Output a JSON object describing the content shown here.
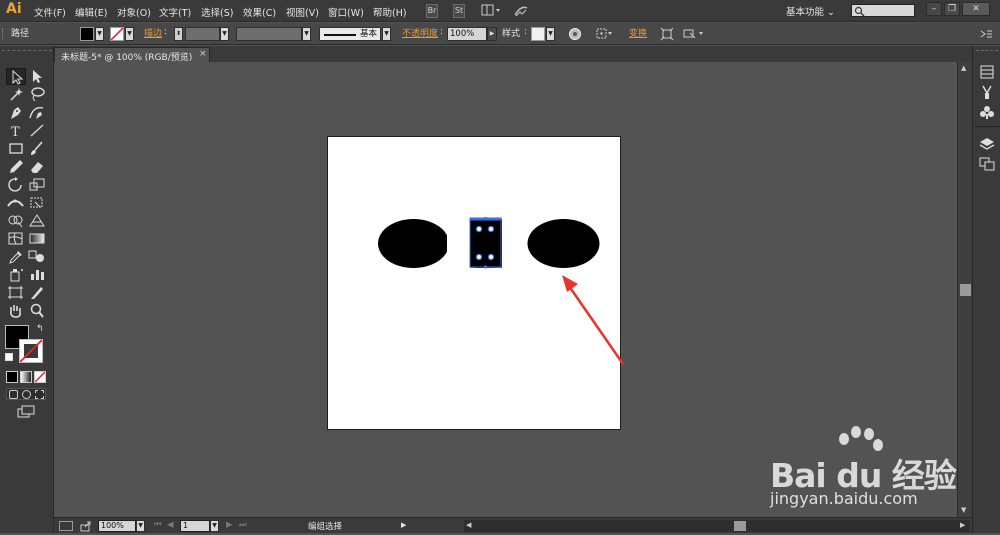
{
  "app": {
    "logo_text": "Ai"
  },
  "menu": {
    "items": [
      "文件(F)",
      "编辑(E)",
      "对象(O)",
      "文字(T)",
      "选择(S)",
      "效果(C)",
      "视图(V)",
      "窗口(W)",
      "帮助(H)"
    ],
    "br_label": "Br",
    "st_label": "St",
    "workspace_label": "基本功能 ⌄",
    "search_placeholder": ""
  },
  "control_bar": {
    "selection_label": "路径",
    "stroke_label": "描边",
    "stroke_style_label": "基本",
    "opacity_label": "不透明度",
    "opacity_value": "100%",
    "style_label": "样式",
    "transform_label": "变换",
    "fill_color": "#000000",
    "accent_color": "#e89a3c"
  },
  "document": {
    "tab_title": "未标题-5* @ 100% (RGB/预览)",
    "tab_close": "×"
  },
  "status_bar": {
    "zoom_value": "100%",
    "page_value": "1",
    "tool_status": "编组选择"
  },
  "watermark": {
    "brand_text": "Bai du 经验",
    "url_text": "jingyan.baidu.com"
  }
}
